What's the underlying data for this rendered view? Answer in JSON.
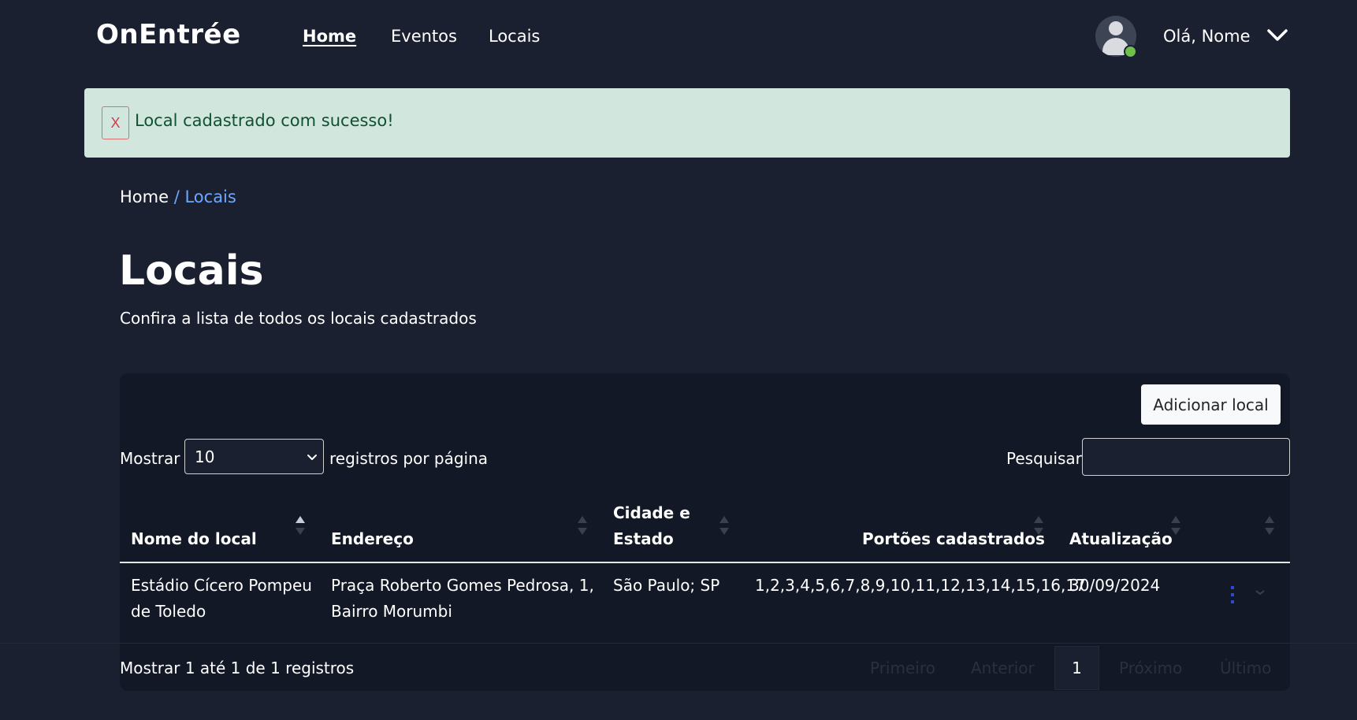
{
  "app": {
    "brand": "OnEntrée"
  },
  "nav": {
    "links": [
      {
        "label": "Home",
        "active": true
      },
      {
        "label": "Eventos",
        "active": false
      },
      {
        "label": "Locais",
        "active": false
      }
    ],
    "greeting": "Olá, Nome"
  },
  "alert": {
    "close_label": "X",
    "message": "Local cadastrado com sucesso!"
  },
  "breadcrumb": {
    "home": "Home",
    "separator": "/",
    "current": "Locais"
  },
  "page": {
    "title": "Locais",
    "subtitle": "Confira a lista de todos os locais cadastrados"
  },
  "toolbar": {
    "add_button": "Adicionar local",
    "show_label": "Mostrar",
    "page_size_value": "10",
    "per_page_label": "registros por página",
    "search_label": "Pesquisar",
    "search_value": ""
  },
  "table": {
    "columns": [
      "Nome do local",
      "Endereço",
      "Cidade e Estado",
      "Portões cadastrados",
      "Atualização"
    ],
    "column_lines": {
      "city_line1": "Cidade e",
      "city_line2": "Estado"
    },
    "rows": [
      {
        "name_line1": "Estádio Cícero Pompeu",
        "name_line2": "de Toledo",
        "address_line1": "Praça Roberto Gomes Pedrosa, 1,",
        "address_line2": "Bairro Morumbi",
        "city": "São Paulo; SP",
        "gates": "1,2,3,4,5,6,7,8,9,10,11,12,13,14,15,16,17",
        "updated": "30/09/2024"
      }
    ]
  },
  "footer": {
    "info": "Mostrar 1 até 1 de 1 registros",
    "pagination": {
      "first": "Primeiro",
      "previous": "Anterior",
      "current": "1",
      "next": "Próximo",
      "last": "Último"
    }
  },
  "colors": {
    "background": "#1b2030",
    "card": "#131826",
    "alert_bg": "#d1e7dd",
    "alert_text": "#0f5132",
    "link_accent": "#6ea8fe",
    "online": "#6fbf4a"
  }
}
